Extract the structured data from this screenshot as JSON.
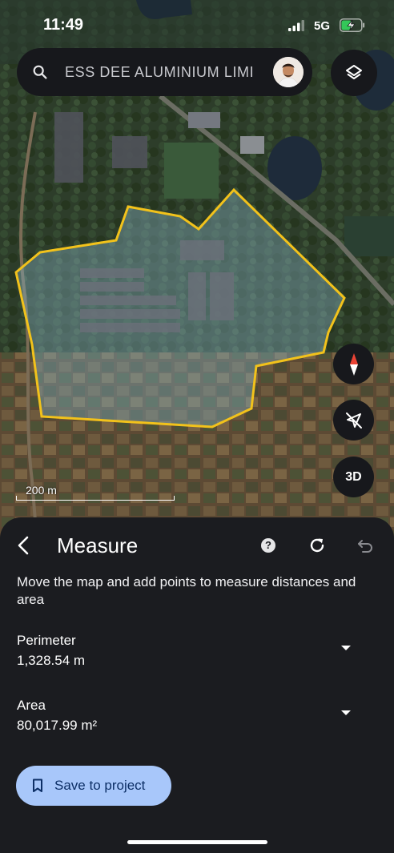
{
  "status_bar": {
    "time": "11:49",
    "network": "5G"
  },
  "search": {
    "query": "ESS DEE ALUMINIUM LIMI"
  },
  "map": {
    "scale_label": "200 m",
    "three_d_label": "3D"
  },
  "measure": {
    "title": "Measure",
    "help_glyph": "?",
    "instructions": "Move the map and add points to measure distances and area",
    "perimeter": {
      "label": "Perimeter",
      "value": "1,328.54 m"
    },
    "area": {
      "label": "Area",
      "value": "80,017.99 m²"
    },
    "save_label": "Save to project"
  },
  "colors": {
    "accent": "#a8c7fa",
    "polygon_outline": "#f2c21b",
    "sheet_bg": "#1b1c20"
  },
  "icons": [
    "search-icon",
    "avatar",
    "layers-icon",
    "compass-icon",
    "tilt-off-icon",
    "back-icon",
    "help-icon",
    "refresh-icon",
    "undo-icon",
    "chevron-down-icon",
    "bookmark-icon"
  ]
}
